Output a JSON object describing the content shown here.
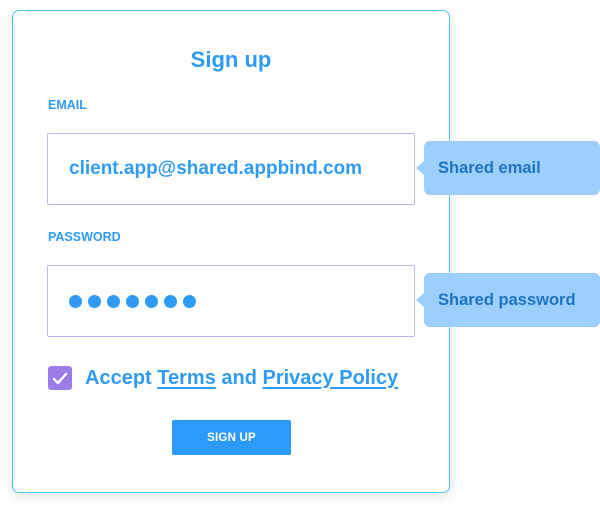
{
  "form": {
    "title": "Sign up",
    "email_label": "EMAIL",
    "email_value": "client.app@shared.appbind.com",
    "password_label": "PASSWORD",
    "password_masked_length": 7,
    "accept_checked": true,
    "accept_prefix": "Accept",
    "terms_link": "Terms",
    "accept_and": "and",
    "privacy_link": "Privacy Policy",
    "submit_label": "SIGN UP"
  },
  "annotations": {
    "email_callout": "Shared email",
    "password_callout": "Shared password"
  },
  "colors": {
    "accent": "#2f9bf5",
    "card_border": "#4fc3f7",
    "input_border": "#c5b3f0",
    "checkbox": "#9c7ce6",
    "callout_bg": "#9ccffc",
    "callout_text": "#1f74c2"
  }
}
